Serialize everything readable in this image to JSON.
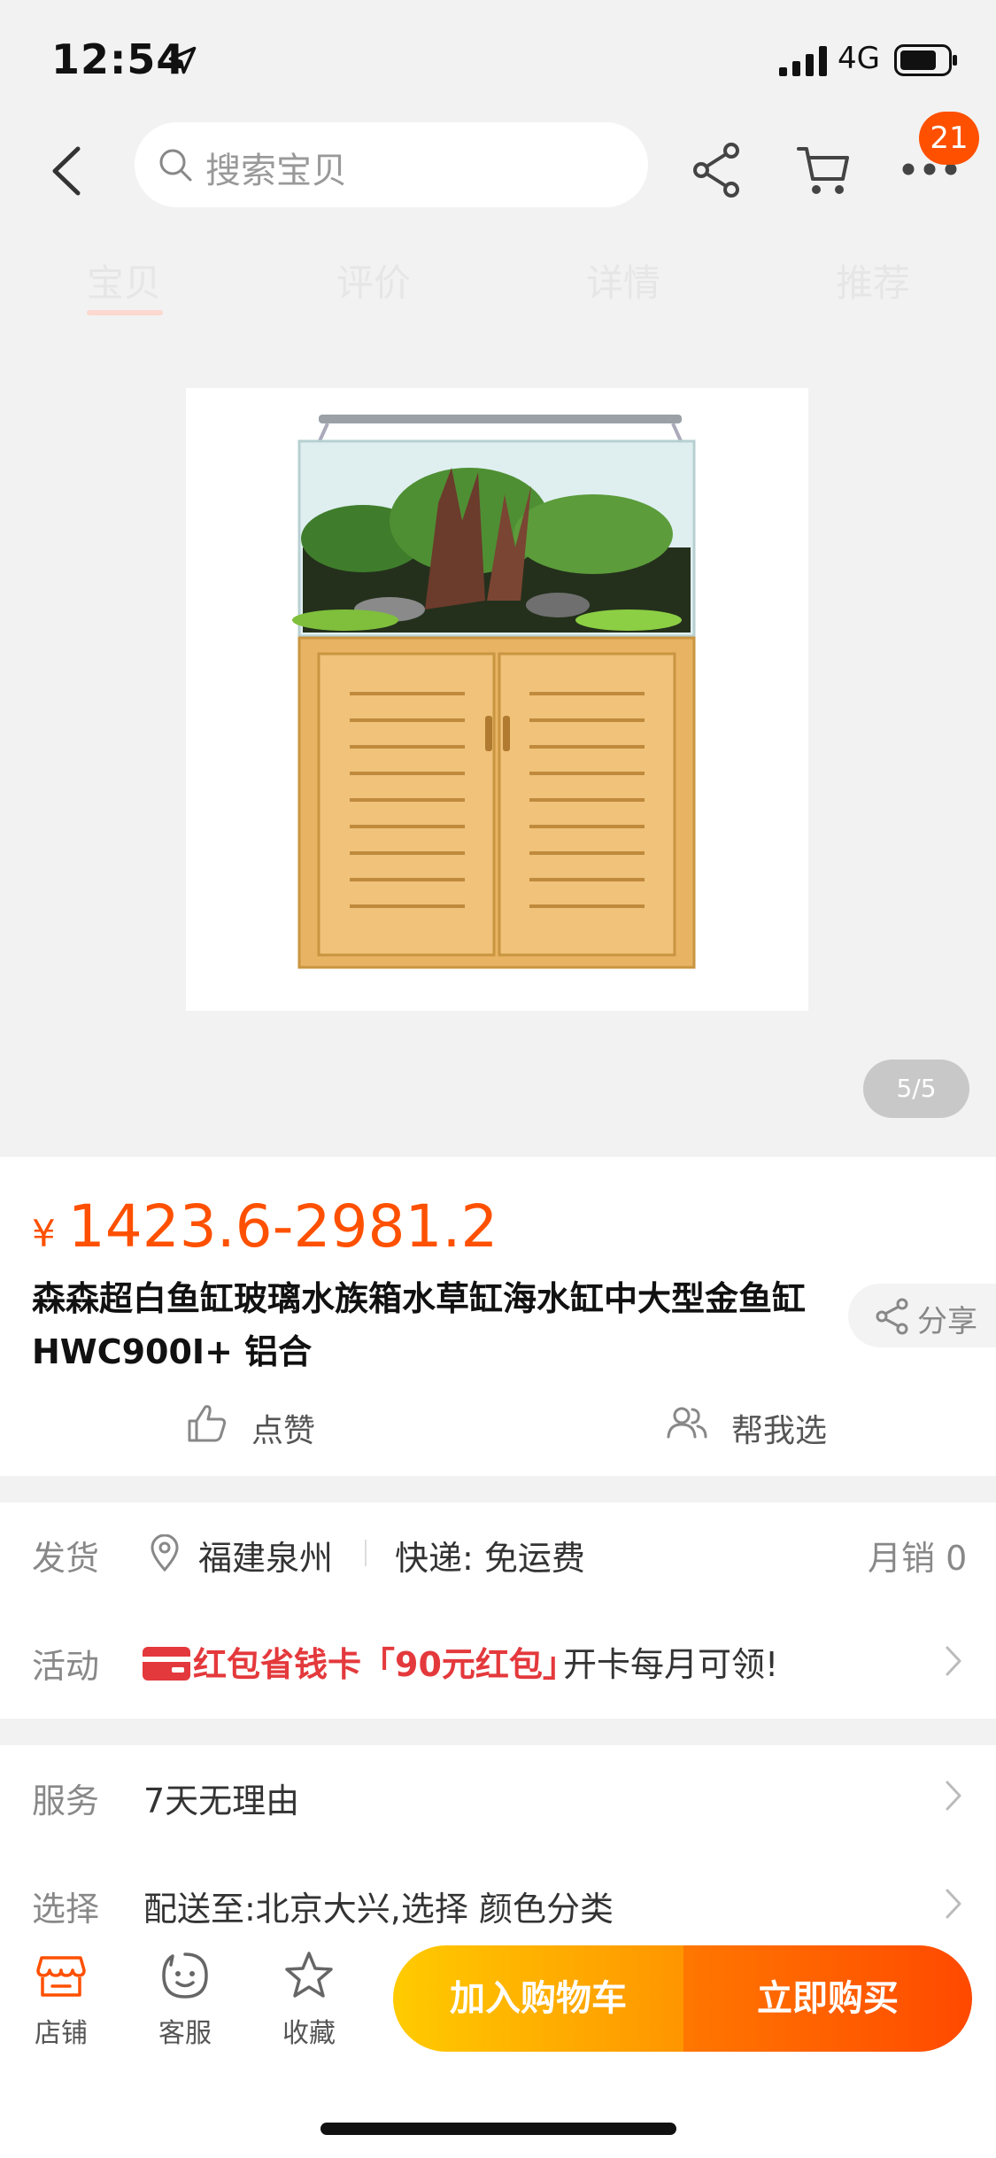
{
  "status_bar": {
    "time": "12:54",
    "network": "4G"
  },
  "nav": {
    "search_placeholder": "搜索宝贝",
    "badge_count": "21"
  },
  "tabs": [
    {
      "label": "宝贝"
    },
    {
      "label": "评价"
    },
    {
      "label": "详情"
    },
    {
      "label": "推荐"
    }
  ],
  "gallery": {
    "counter": "5/5"
  },
  "product": {
    "currency": "¥",
    "price": "1423.6-2981.2",
    "title": "森森超白鱼缸玻璃水族箱水草缸海水缸中大型金鱼缸 HWC900I+ 铝合",
    "share_label": "分享",
    "like_label": "点赞",
    "help_label": "帮我选"
  },
  "shipping": {
    "label": "发货",
    "location": "福建泉州",
    "express": "快递: 免运费",
    "monthly_sales": "月销 0"
  },
  "promo": {
    "label": "活动",
    "highlight": "红包省钱卡「90元红包」",
    "rest": "开卡每月可领!"
  },
  "service": {
    "label": "服务",
    "value": "7天无理由"
  },
  "select": {
    "label": "选择",
    "value": "配送至:北京大兴,选择  颜色分类"
  },
  "bottom_bar": {
    "shop": "店铺",
    "service": "客服",
    "favorite": "收藏",
    "add_to_cart": "加入购物车",
    "buy_now": "立即购买"
  },
  "colors": {
    "accent": "#ff5000",
    "promo_red": "#e4393c",
    "cart_btn": "#ffb400",
    "buy_btn": "#ff5a00"
  },
  "icons": [
    "location-arrow-icon",
    "signal-icon",
    "battery-icon",
    "back-icon",
    "search-icon",
    "share-icon",
    "cart-icon",
    "more-icon",
    "thumb-up-icon",
    "people-icon",
    "map-pin-icon",
    "red-card-icon",
    "chevron-right-icon",
    "shop-icon",
    "customer-service-icon",
    "star-icon"
  ]
}
